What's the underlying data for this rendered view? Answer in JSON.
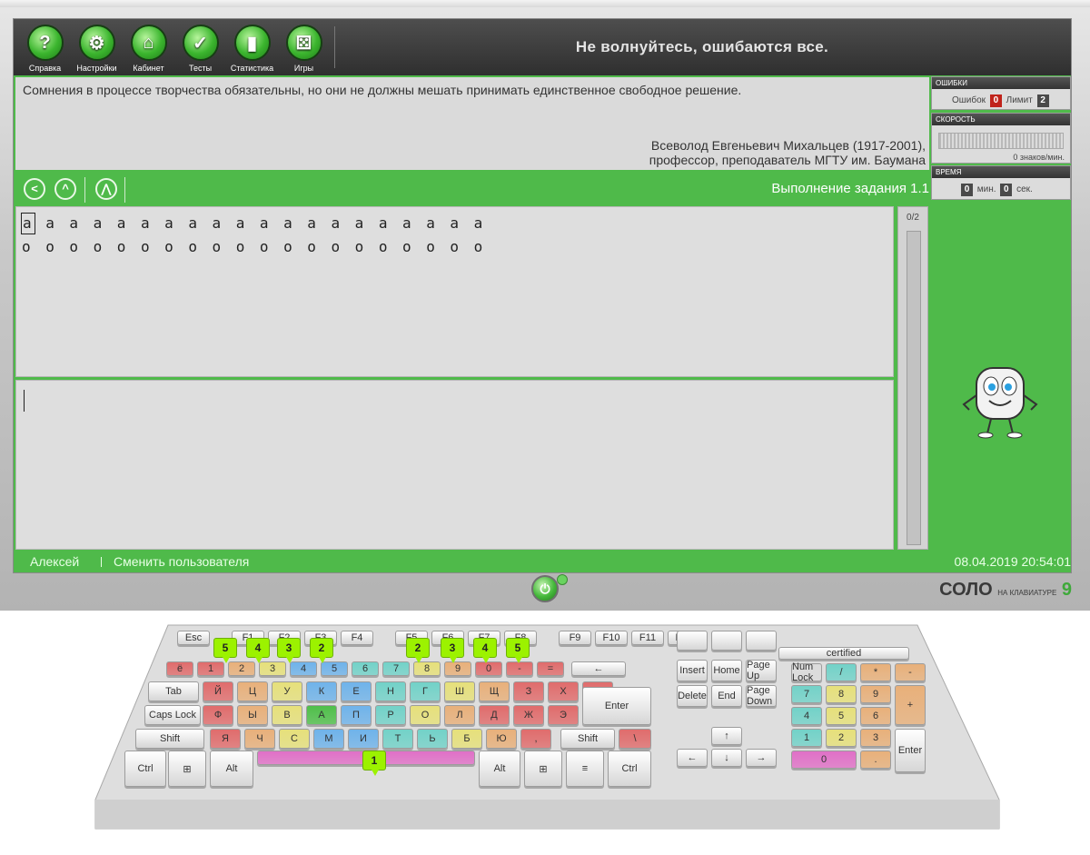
{
  "nav": {
    "items": [
      {
        "label": "Справка",
        "glyph": "?",
        "icon": "help-icon"
      },
      {
        "label": "Настройки",
        "glyph": "⚙",
        "icon": "metronome-icon"
      },
      {
        "label": "Кабинет",
        "glyph": "⌂",
        "icon": "lamp-icon"
      },
      {
        "label": "Тесты",
        "glyph": "✓",
        "icon": "tests-icon"
      },
      {
        "label": "Статистика",
        "glyph": "▮",
        "icon": "chart-icon"
      },
      {
        "label": "Игры",
        "glyph": "⚄",
        "icon": "dice-icon"
      }
    ]
  },
  "header": {
    "motto": "Не волнуйтесь, ошибаются все."
  },
  "quote": {
    "text": "Сомнения в процессе творчества обязательны, но они не должны мешать принимать единственное свободное решение.",
    "author_line1": "Всеволод Евгеньевич Михальцев (1917-2001),",
    "author_line2": "профессор, преподаватель МГТУ им. Баумана"
  },
  "task": {
    "title": "Выполнение задания 1.1"
  },
  "exercise": {
    "line1": [
      "а",
      "а",
      "а",
      "а",
      "а",
      "а",
      "а",
      "а",
      "а",
      "а",
      "а",
      "а",
      "а",
      "а",
      "а",
      "а",
      "а",
      "а",
      "а",
      "а"
    ],
    "line2": [
      "о",
      "о",
      "о",
      "о",
      "о",
      "о",
      "о",
      "о",
      "о",
      "о",
      "о",
      "о",
      "о",
      "о",
      "о",
      "о",
      "о",
      "о",
      "о",
      "о"
    ],
    "progress": "0/2"
  },
  "stats": {
    "errors_title": "ОШИБКИ",
    "errors_label": "Ошибок",
    "errors_value": "0",
    "limit_label": "Лимит",
    "limit_value": "2",
    "speed_title": "СКОРОСТЬ",
    "speed_text": "0 знаков/мин.",
    "time_title": "ВРЕМЯ",
    "minutes": "0",
    "minutes_label": "мин.",
    "seconds": "0",
    "seconds_label": "сек."
  },
  "footer": {
    "user": "Алексей",
    "switch_user": "Сменить пользователя",
    "datetime": "08.04.2019 20:54:01"
  },
  "brand": {
    "name": "СОЛО",
    "sub": "НА КЛАВИАТУРЕ",
    "number": "9"
  },
  "colors": {
    "screen_green": "#4fba4a",
    "error_red": "#c0231b",
    "chip_gray": "#4a4a4a"
  },
  "keyboard": {
    "function_row": [
      "Esc",
      "F1",
      "F2",
      "F3",
      "F4",
      "F5",
      "F6",
      "F7",
      "F8",
      "F9",
      "F10",
      "F11",
      "F12"
    ],
    "number_row": [
      "ё",
      "1",
      "2",
      "3",
      "4",
      "5",
      "6",
      "7",
      "8",
      "9",
      "0",
      "-",
      "="
    ],
    "row_q": [
      "Tab",
      "Й",
      "Ц",
      "У",
      "К",
      "Е",
      "Н",
      "Г",
      "Ш",
      "Щ",
      "З",
      "Х",
      "Ъ"
    ],
    "row_a": [
      "Caps Lock",
      "Ф",
      "Ы",
      "В",
      "А",
      "П",
      "Р",
      "О",
      "Л",
      "Д",
      "Ж",
      "Э",
      "Enter"
    ],
    "row_z": [
      "Shift",
      "Я",
      "Ч",
      "С",
      "М",
      "И",
      "Т",
      "Ь",
      "Б",
      "Ю",
      ",",
      "Shift",
      "\\"
    ],
    "row_bottom": [
      "Ctrl",
      "Alt",
      "Alt",
      "Ctrl"
    ],
    "nav_block": [
      "Insert",
      "Home",
      "Page Up",
      "Delete",
      "End",
      "Page Down"
    ],
    "numpad": [
      "Num Lock",
      "/",
      "*",
      "-",
      "7",
      "8",
      "9",
      "+",
      "4",
      "5",
      "6",
      "1",
      "2",
      "3",
      "Enter",
      "0",
      "."
    ],
    "certified": "certified",
    "fingers_left": [
      "5",
      "4",
      "3",
      "2"
    ],
    "fingers_right": [
      "2",
      "3",
      "4",
      "5"
    ],
    "thumb": "1"
  }
}
